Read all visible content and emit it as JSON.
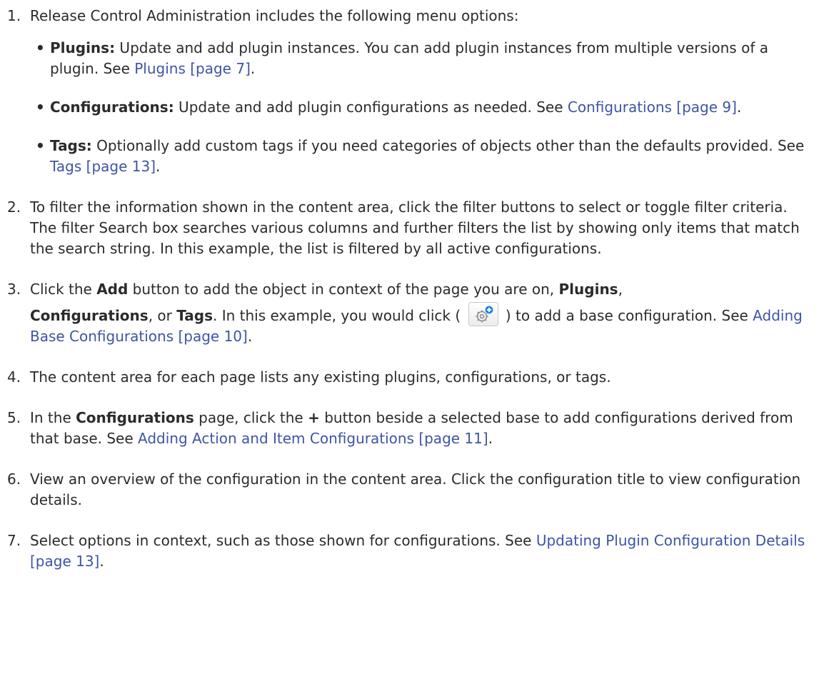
{
  "steps": [
    {
      "num": "1.",
      "intro": "Release Control Administration includes the following menu options:",
      "items": [
        {
          "label": "Plugins:",
          "text": " Update and add plugin instances. You can add plugin instances from multiple versions of a plugin. See ",
          "link": "Plugins [page 7]",
          "end": "."
        },
        {
          "label": "Configurations:",
          "text": " Update and add plugin configurations as needed. See ",
          "link": "Configurations [page 9]",
          "end": "."
        },
        {
          "label": "Tags:",
          "text": " Optionally add custom tags if you need categories of objects other than the defaults provided. See ",
          "link": "Tags [page 13]",
          "end": "."
        }
      ]
    },
    {
      "num": "2.",
      "text": "To filter the information shown in the content area, click the filter buttons to select or toggle filter criteria. The filter Search box searches various columns and further filters the list by showing only items that match the search string. In this example, the list is filtered by all active configurations."
    },
    {
      "num": "3.",
      "t1": "Click the ",
      "b1": "Add",
      "t2": " button to add the object in context of the page you are on, ",
      "b2": "Plugins",
      "t3": ",",
      "b3": "Configurations",
      "t4": ", or ",
      "b4": "Tags",
      "t5": ". In this example, you would click ( ",
      "t6": " ) to add a base configuration. See ",
      "link": "Adding Base Configurations [page 10]",
      "end": "."
    },
    {
      "num": "4.",
      "text": "The content area for each page lists any existing plugins, configurations, or tags."
    },
    {
      "num": "5.",
      "t1": "In the ",
      "b1": "Configurations",
      "t2": " page, click the ",
      "b2": "+",
      "t3": " button beside a selected base to add configurations derived from that base. See ",
      "link": "Adding Action and Item Configurations [page 11]",
      "end": "."
    },
    {
      "num": "6.",
      "text": "View an overview of the configuration in the content area. Click the configuration title to view configuration details."
    },
    {
      "num": "7.",
      "text": "Select options in context, such as those shown for configurations. See ",
      "link": "Updating Plugin Configuration Details [page 13]",
      "end": "."
    }
  ],
  "bullet_char": "•",
  "icons": {
    "add_config": "gear-plus-icon"
  },
  "colors": {
    "link": "#3d55a4",
    "text": "#2b2b2b",
    "icon_badge": "#1e88e5"
  }
}
